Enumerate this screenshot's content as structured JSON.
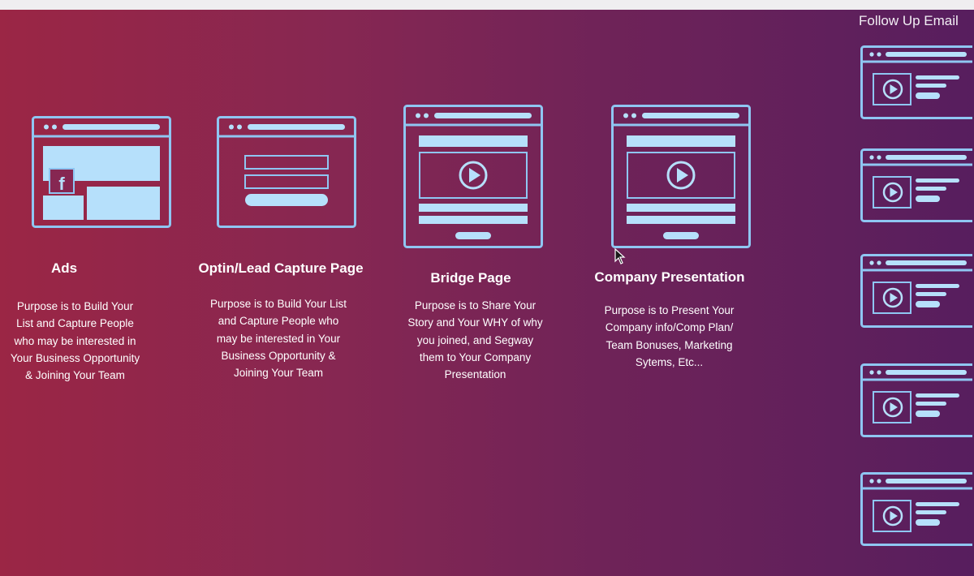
{
  "stages": [
    {
      "id": "ads",
      "title": "Ads",
      "description": "Purpose is to Build Your List and Capture People who may be interested in Your Business Opportunity & Joining Your Team",
      "icon": "facebook-ad-page-icon"
    },
    {
      "id": "optin",
      "title": "Optin/Lead Capture Page",
      "description": "Purpose is to Build Your List and Capture People who may be interested in Your Business Opportunity & Joining Your Team",
      "icon": "form-page-icon"
    },
    {
      "id": "bridge",
      "title": "Bridge Page",
      "description": "Purpose is to Share Your Story and Your WHY of why you joined, and Segway them to Your Company Presentation",
      "icon": "video-page-icon"
    },
    {
      "id": "company",
      "title": "Company Presentation",
      "description": "Purpose is to Present Your Company info/Comp Plan/ Team Bonuses, Marketing Sytems, Etc...",
      "icon": "video-page-icon"
    }
  ],
  "follow_up": {
    "title": "Follow Up Email",
    "email_count": 5,
    "icon": "video-email-icon"
  },
  "colors": {
    "icon_stroke": "#8fc6f2",
    "icon_fill": "#b6e0fb",
    "gradient_left": "#9b2645",
    "gradient_right": "#571e5e"
  }
}
